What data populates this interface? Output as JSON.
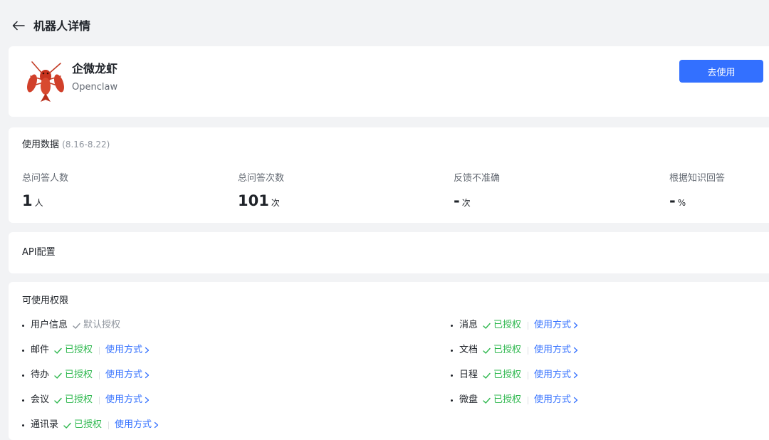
{
  "header": {
    "title": "机器人详情",
    "back_icon": "arrow-left-icon"
  },
  "bot": {
    "name": "企微龙虾",
    "subtitle": "Openclaw",
    "avatar_icon": "crayfish-icon",
    "use_button": "去使用"
  },
  "usage": {
    "title": "使用数据",
    "range": "(8.16-8.22)",
    "stats": [
      {
        "label": "总问答人数",
        "value": "1",
        "unit": "人"
      },
      {
        "label": "总问答次数",
        "value": "101",
        "unit": "次"
      },
      {
        "label": "反馈不准确",
        "value": "-",
        "unit": "次"
      },
      {
        "label": "根据知识回答",
        "value": "-",
        "unit": "%"
      }
    ]
  },
  "api": {
    "title": "API配置"
  },
  "permissions": {
    "title": "可使用权限",
    "usage_link": "使用方式",
    "items": [
      {
        "name": "用户信息",
        "status": "默认授权"
      },
      {
        "name": "邮件",
        "status": "已授权"
      },
      {
        "name": "待办",
        "status": "已授权"
      },
      {
        "name": "会议",
        "status": "已授权"
      },
      {
        "name": "通讯录",
        "status": "已授权"
      },
      {
        "name": "消息",
        "status": "已授权"
      },
      {
        "name": "文档",
        "status": "已授权"
      },
      {
        "name": "日程",
        "status": "已授权"
      },
      {
        "name": "微盘",
        "status": "已授权"
      }
    ]
  },
  "colors": {
    "primary": "#3370ff",
    "success": "#2fb84f",
    "muted": "#8f959e",
    "background": "#f2f3f5"
  }
}
